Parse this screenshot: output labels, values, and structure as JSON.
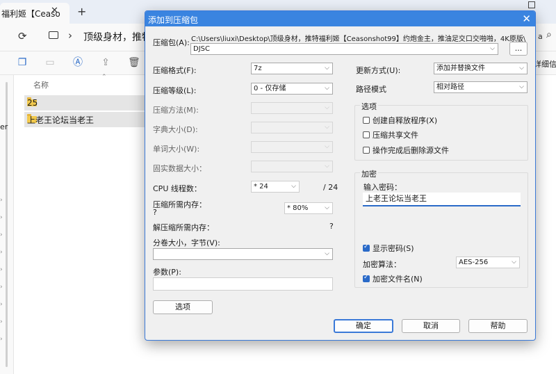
{
  "explorer": {
    "tab_title": "福利姬【Ceaso",
    "breadcrumb": "顶级身材，推特福",
    "right_cut_letter": "a",
    "details_cut": "详细信息",
    "nav_cut_label": "er",
    "column_name": "名称",
    "rows": [
      {
        "name": "25"
      },
      {
        "name": "上老王论坛当老王"
      }
    ]
  },
  "dialog": {
    "title": "添加到压缩包",
    "archive_label": "压缩包(A):",
    "archive_path": "C:\\Users\\liuxi\\Desktop\\顶级身材，推特福利姬【Ceasonshot99】约炮金主，推油足交口交啪啪，4K原版\\",
    "archive_name": "DJSC",
    "browse_label": "...",
    "format_label": "压缩格式(F):",
    "format_value": "7z",
    "level_label": "压缩等级(L):",
    "level_value": "0 - 仅存储",
    "method_label": "压缩方法(M):",
    "dict_label": "字典大小(D):",
    "word_label": "单词大小(W):",
    "solid_label": "固实数据大小：",
    "cpu_label": "CPU 线程数：",
    "cpu_value": "* 24",
    "cpu_max": "/ 24",
    "mem_label": "压缩所需内存：",
    "mem_q": "?",
    "mem_value": "* 80%",
    "decomp_label": "解压缩所需内存：",
    "decomp_q": "?",
    "split_label": "分卷大小，字节(V):",
    "params_label": "参数(P):",
    "options_btn": "选项",
    "update_label": "更新方式(U):",
    "update_value": "添加并替换文件",
    "path_mode_label": "路径模式",
    "path_mode_value": "相对路径",
    "options_group": "选项",
    "opt_sfx": "创建自释放程序(X)",
    "opt_shared": "压缩共享文件",
    "opt_delete": "操作完成后删除源文件",
    "encrypt_group": "加密",
    "pwd_label": "输入密码：",
    "pwd_value": "上老王论坛当老王",
    "show_pwd": "显示密码(S)",
    "enc_method_label": "加密算法：",
    "enc_method_value": "AES-256",
    "enc_names": "加密文件名(N)",
    "ok": "确定",
    "cancel": "取消",
    "help": "帮助"
  }
}
